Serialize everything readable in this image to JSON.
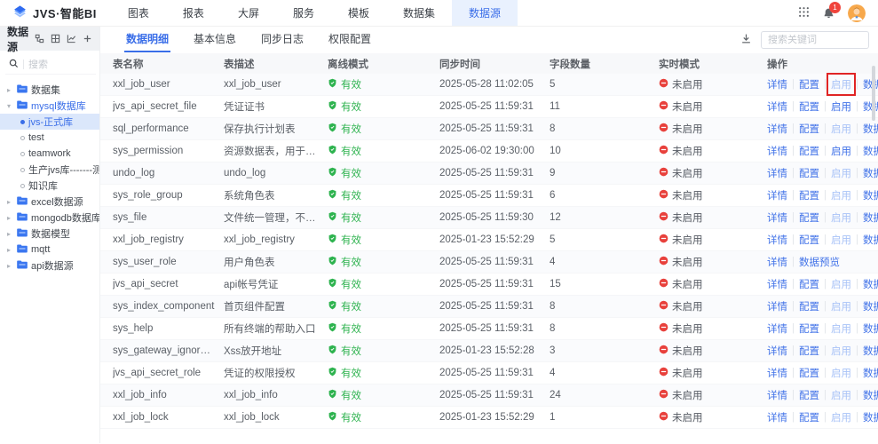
{
  "topnav": {
    "logo_text": "JVS·智能BI",
    "items": [
      {
        "label": "图表"
      },
      {
        "label": "报表"
      },
      {
        "label": "大屏"
      },
      {
        "label": "服务"
      },
      {
        "label": "模板"
      },
      {
        "label": "数据集"
      },
      {
        "label": "数据源"
      }
    ],
    "active": "数据源",
    "bell_badge": "1"
  },
  "sidebar": {
    "title": "数据源",
    "search_placeholder": "搜索",
    "tree": [
      {
        "label": "数据集",
        "kind": "folder"
      },
      {
        "label": "mysql数据库",
        "kind": "folder",
        "expanded": true,
        "highlight": true
      },
      {
        "label": "jvs-正式库",
        "kind": "leaf",
        "selected": true
      },
      {
        "label": "test",
        "kind": "leaf"
      },
      {
        "label": "teamwork",
        "kind": "leaf"
      },
      {
        "label": "生产jvs库-------测试",
        "kind": "leaf"
      },
      {
        "label": "知识库",
        "kind": "leaf"
      },
      {
        "label": "excel数据源",
        "kind": "folder"
      },
      {
        "label": "mongodb数据库",
        "kind": "folder"
      },
      {
        "label": "数据模型",
        "kind": "folder"
      },
      {
        "label": "mqtt",
        "kind": "folder"
      },
      {
        "label": "api数据源",
        "kind": "folder"
      }
    ]
  },
  "main": {
    "tabs": [
      "数据明细",
      "基本信息",
      "同步日志",
      "权限配置"
    ],
    "active_tab": "数据明细",
    "search_placeholder": "搜索关键词",
    "table": {
      "headers": [
        "表名称",
        "表描述",
        "离线模式",
        "同步时间",
        "字段数量",
        "实时模式",
        "操作"
      ],
      "offline_label": "有效",
      "realtime_label": "未启用",
      "op_labels": [
        "详情",
        "配置",
        "启用",
        "数据预览"
      ],
      "rows": [
        {
          "name": "xxl_job_user",
          "desc": "xxl_job_user",
          "sync": "2025-05-28 11:02:05",
          "fields": 5,
          "enable": "light",
          "annotated": true
        },
        {
          "name": "jvs_api_secret_file",
          "desc": "凭证证书",
          "sync": "2025-05-25 11:59:31",
          "fields": 11,
          "enable": "normal"
        },
        {
          "name": "sql_performance",
          "desc": "保存执行计划表",
          "sync": "2025-05-25 11:59:31",
          "fields": 8,
          "enable": "light"
        },
        {
          "name": "sys_permission",
          "desc": "资源数据表，用于统计所有项目的…",
          "sync": "2025-06-02 19:30:00",
          "fields": 10,
          "enable": "normal"
        },
        {
          "name": "undo_log",
          "desc": "undo_log",
          "sync": "2025-05-25 11:59:31",
          "fields": 9,
          "enable": "light"
        },
        {
          "name": "sys_role_group",
          "desc": "系统角色表",
          "sync": "2025-05-25 11:59:31",
          "fields": 6,
          "enable": "light"
        },
        {
          "name": "sys_file",
          "desc": "文件统一管理，不包含租户信息，…",
          "sync": "2025-05-25 11:59:30",
          "fields": 12,
          "enable": "light"
        },
        {
          "name": "xxl_job_registry",
          "desc": "xxl_job_registry",
          "sync": "2025-01-23 15:52:29",
          "fields": 5,
          "enable": "light"
        },
        {
          "name": "sys_user_role",
          "desc": "用户角色表",
          "sync": "2025-05-25 11:59:31",
          "fields": 4,
          "ops": "limited"
        },
        {
          "name": "jvs_api_secret",
          "desc": "api帐号凭证",
          "sync": "2025-05-25 11:59:31",
          "fields": 15,
          "enable": "light"
        },
        {
          "name": "sys_index_component",
          "desc": "首页组件配置",
          "sync": "2025-05-25 11:59:31",
          "fields": 8,
          "enable": "light"
        },
        {
          "name": "sys_help",
          "desc": "所有终端的帮助入口",
          "sync": "2025-05-25 11:59:31",
          "fields": 8,
          "enable": "light"
        },
        {
          "name": "sys_gateway_ignore_xss",
          "desc": "Xss放开地址",
          "sync": "2025-01-23 15:52:28",
          "fields": 3,
          "enable": "light"
        },
        {
          "name": "jvs_api_secret_role",
          "desc": "凭证的权限授权",
          "sync": "2025-05-25 11:59:31",
          "fields": 4,
          "enable": "light"
        },
        {
          "name": "xxl_job_info",
          "desc": "xxl_job_info",
          "sync": "2025-05-25 11:59:31",
          "fields": 24,
          "enable": "light"
        },
        {
          "name": "xxl_job_lock",
          "desc": "xxl_job_lock",
          "sync": "2025-01-23 15:52:29",
          "fields": 1,
          "enable": "light"
        }
      ]
    }
  },
  "colors": {
    "primary": "#3a6ee8",
    "link": "#4273e8",
    "link_light": "#a9c3f7",
    "success": "#2eb34f",
    "danger": "#e8413c",
    "annotation": "#e02424",
    "nav_active_bg": "#e9f1fe",
    "tree_selected_bg": "#dbe7fb"
  }
}
